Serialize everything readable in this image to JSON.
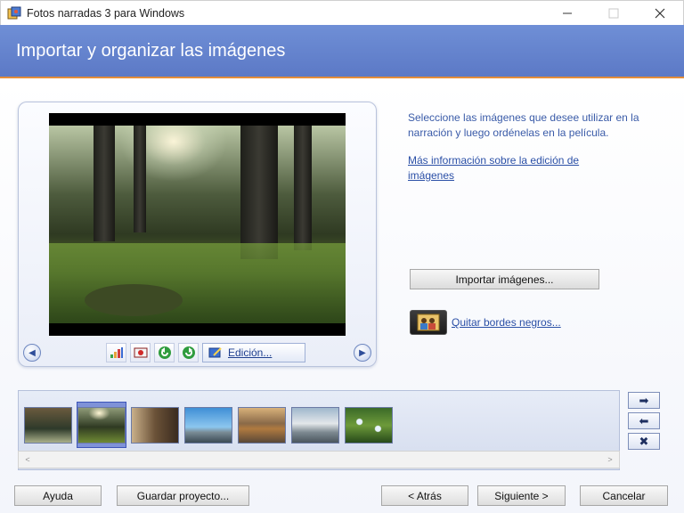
{
  "window": {
    "title": "Fotos narradas 3 para Windows",
    "app_icon": "photo-story-icon",
    "controls": {
      "minimize": "—",
      "maximize": "☐",
      "close": "✕"
    }
  },
  "header": {
    "title": "Importar y organizar las imágenes",
    "accent_color": "#5f7cc9",
    "underline_color": "#e58d3a"
  },
  "preview": {
    "prev_icon": "chevron-left-icon",
    "next_icon": "chevron-right-icon",
    "tools": [
      "auto-correct-icon",
      "red-eye-icon",
      "rotate-left-icon",
      "rotate-right-icon"
    ],
    "edit_label": "Edición..."
  },
  "right_panel": {
    "instructions": "Seleccione las imágenes que desee utilizar en la narración y luego ordénelas en la película.",
    "info_link": "Más información sobre la edición de imágenes",
    "import_button": "Importar imágenes...",
    "remove_borders_link": "Quitar bordes negros..."
  },
  "filmstrip": {
    "thumbnails": [
      {
        "name": "thumb-1",
        "selected": false
      },
      {
        "name": "thumb-2",
        "selected": true
      },
      {
        "name": "thumb-3",
        "selected": false
      },
      {
        "name": "thumb-4",
        "selected": false
      },
      {
        "name": "thumb-5",
        "selected": false
      },
      {
        "name": "thumb-6",
        "selected": false
      },
      {
        "name": "thumb-7",
        "selected": false
      }
    ],
    "move_right_icon": "arrow-right-icon",
    "move_left_icon": "arrow-left-icon",
    "delete_icon": "delete-x-icon"
  },
  "footer": {
    "help": "Ayuda",
    "save": "Guardar proyecto...",
    "back": "< Atrás",
    "next": "Siguiente >",
    "cancel": "Cancelar"
  }
}
